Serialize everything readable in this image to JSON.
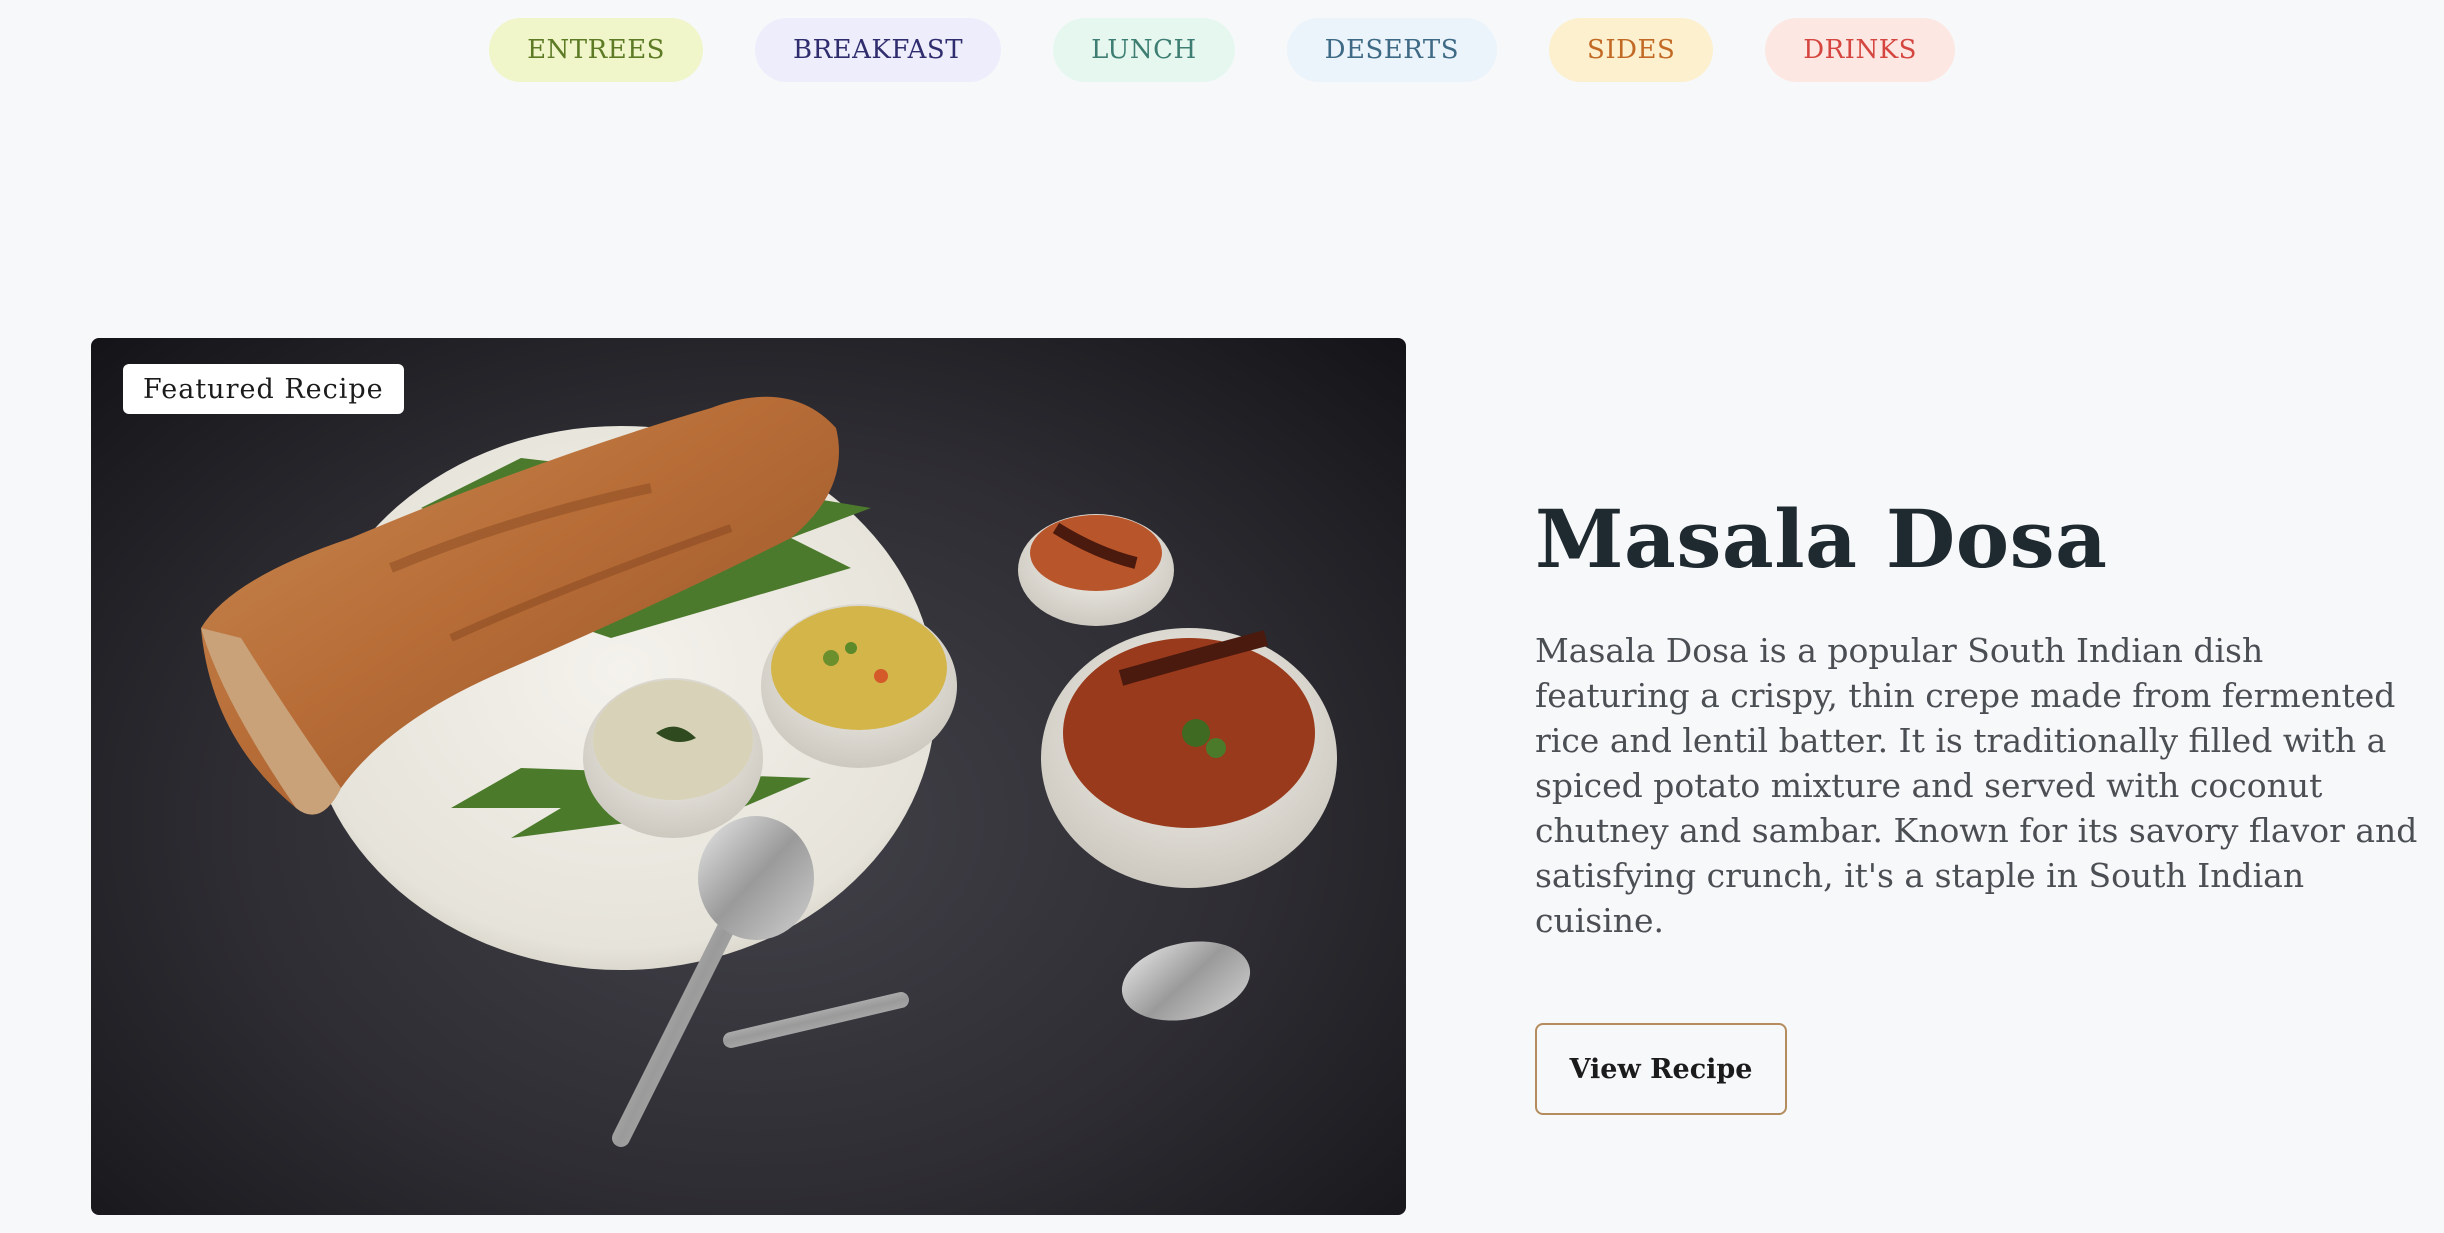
{
  "categories": [
    {
      "label": "ENTREES"
    },
    {
      "label": "BREAKFAST"
    },
    {
      "label": "LUNCH"
    },
    {
      "label": "DESERTS"
    },
    {
      "label": "SIDES"
    },
    {
      "label": "DRINKS"
    }
  ],
  "featured": {
    "badge": "Featured Recipe",
    "title": "Masala Dosa",
    "description": "Masala Dosa is a popular South Indian dish featuring a crispy, thin crepe made from fermented rice and lentil batter. It is traditionally filled with a spiced potato mixture and served with coconut chutney and sambar. Known for its savory flavor and satisfying crunch, it's a staple in South Indian cuisine.",
    "button_label": "View Recipe",
    "image_icon": "masala-dosa-photo"
  },
  "colors": {
    "background": "#f7f8fa",
    "button_border": "#b48c5e",
    "title": "#1f2a30"
  }
}
